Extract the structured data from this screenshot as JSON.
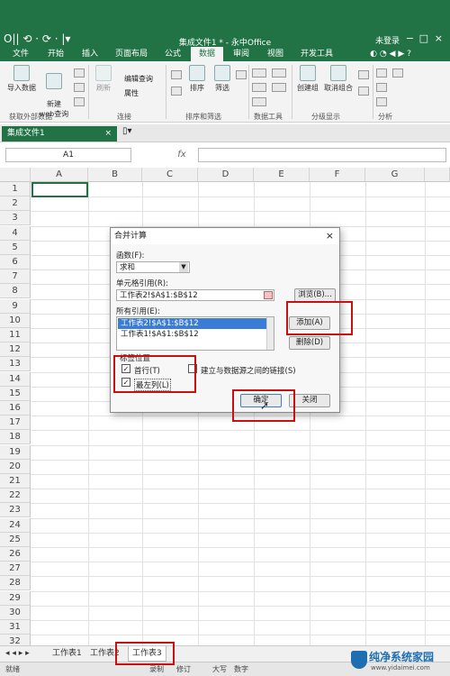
{
  "window": {
    "title": "集成文件1 * - 永中Office",
    "login": "未登录",
    "quick_access": "O|| ⟲ · ⟳ · |▾",
    "win_min": "−",
    "win_max": "□",
    "win_close": "×"
  },
  "tabs": [
    "文件",
    "开始",
    "插入",
    "页面布局",
    "公式",
    "数据",
    "审阅",
    "视图",
    "开发工具"
  ],
  "active_tab": "数据",
  "ribbon": {
    "import_label": "导入数据",
    "new_web_label": "新建\nweb查询",
    "refresh_label": "刷新",
    "edit_query_label": "编辑查询",
    "properties_label": "属性",
    "sort_label": "排序",
    "filter_label": "筛选",
    "group_label": "创建组",
    "ungroup_label": "取消组合",
    "groups": [
      "获取外部数据",
      "连接",
      "排序和筛选",
      "数据工具",
      "分级显示",
      "分析"
    ]
  },
  "doc_tab": {
    "name": "集成文件1",
    "close": "×"
  },
  "formula_bar": {
    "cell_ref": "A1",
    "fx": "fx"
  },
  "grid": {
    "columns": [
      "A",
      "B",
      "C",
      "D",
      "E",
      "F",
      "G"
    ],
    "rows": [
      "1",
      "2",
      "3",
      "4",
      "5",
      "6",
      "7",
      "8",
      "9",
      "10",
      "11",
      "12",
      "13",
      "14",
      "15",
      "16",
      "17",
      "18",
      "19",
      "20",
      "21",
      "22",
      "23",
      "24",
      "25",
      "26",
      "27",
      "28",
      "29",
      "30",
      "31",
      "32"
    ]
  },
  "sheets": [
    "工作表1",
    "工作表2",
    "工作表3"
  ],
  "active_sheet": "工作表3",
  "sheet_nav": "◂ ◂ ▸ ▸",
  "status": {
    "ready": "就绪",
    "caps": "大写",
    "num": "数字",
    "rec": "录制",
    "rev": "修订"
  },
  "dialog": {
    "title": "合并计算",
    "close": "×",
    "function_label": "函数(F):",
    "function_value": "求和",
    "ref_label": "单元格引用(R):",
    "ref_value": "工作表2!$A$1:$B$12",
    "browse_button": "浏览(B)...",
    "all_refs_label": "所有引用(E):",
    "all_refs": [
      "工作表2!$A$1:$B$12",
      "工作表1!$A$1:$B$12"
    ],
    "add_button": "添加(A)",
    "delete_button": "删除(D)",
    "label_position": "标签位置",
    "top_row": "首行(T)",
    "left_col": "最左列(L)",
    "link_source": "建立与数据源之间的链接(S)",
    "ok_button": "确定",
    "close_button": "关闭"
  },
  "watermark": {
    "title": "纯净系统家园",
    "url": "www.yidaimei.com"
  },
  "colors": {
    "accent": "#217346",
    "highlight": "#c81010",
    "selection": "#3b7cd6"
  }
}
